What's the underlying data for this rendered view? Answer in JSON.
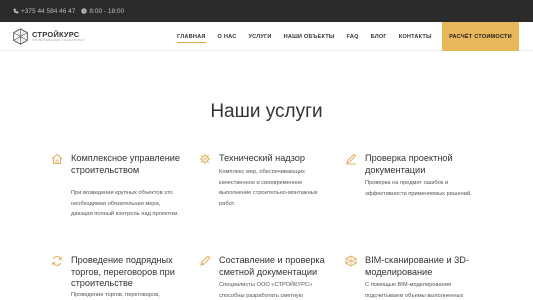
{
  "topbar": {
    "phone": "+375 44 584 46 47",
    "hours": "8:00 - 18:00"
  },
  "logo": {
    "name": "СТРОЙКУРС",
    "tagline": "СТРОИТЕЛЬНЫЙ КОНСАЛТИНГ"
  },
  "nav": {
    "items": [
      {
        "label": "ГЛАВНАЯ"
      },
      {
        "label": "О НАС"
      },
      {
        "label": "УСЛУГИ"
      },
      {
        "label": "НАШИ ОБЪЕКТЫ"
      },
      {
        "label": "FAQ"
      },
      {
        "label": "БЛОГ"
      },
      {
        "label": "КОНТАКТЫ"
      }
    ],
    "cta": "РАСЧЁТ СТОИМОСТИ"
  },
  "section": {
    "title": "Наши услуги"
  },
  "services": [
    {
      "icon": "house-icon",
      "title": "Комплексное управление строительством",
      "desc": "При возведении крупных объектов это необходимая обязательная мера, дающая полный контроль над проектом."
    },
    {
      "icon": "gear-icon",
      "title": "Технический надзор",
      "desc": "Комплекс мер, обеспечивающих качественное и своевременное выполнение строительно-монтажных работ."
    },
    {
      "icon": "pen-icon",
      "title": "Проверка проектной документации",
      "desc": "Проверка на предмет ошибок и эффективности применяемых решений."
    },
    {
      "icon": "refresh-icon",
      "title": "Проведение подрядных торгов, переговоров при строительстве",
      "desc": "Проведение торгов, переговоров,"
    },
    {
      "icon": "pencil-icon",
      "title": "Составление и проверка сметной документации",
      "desc": "Специалисты ООО «СТРОЙКУРС» способны разработать сметную"
    },
    {
      "icon": "bim-icon",
      "title": "BIM-сканирование и 3D-моделирование",
      "desc": "С помощью BIM-моделирования подсчитываем объемы выполненных"
    }
  ],
  "colors": {
    "accent": "#e8b65b",
    "topbar": "#2b2b2b"
  }
}
